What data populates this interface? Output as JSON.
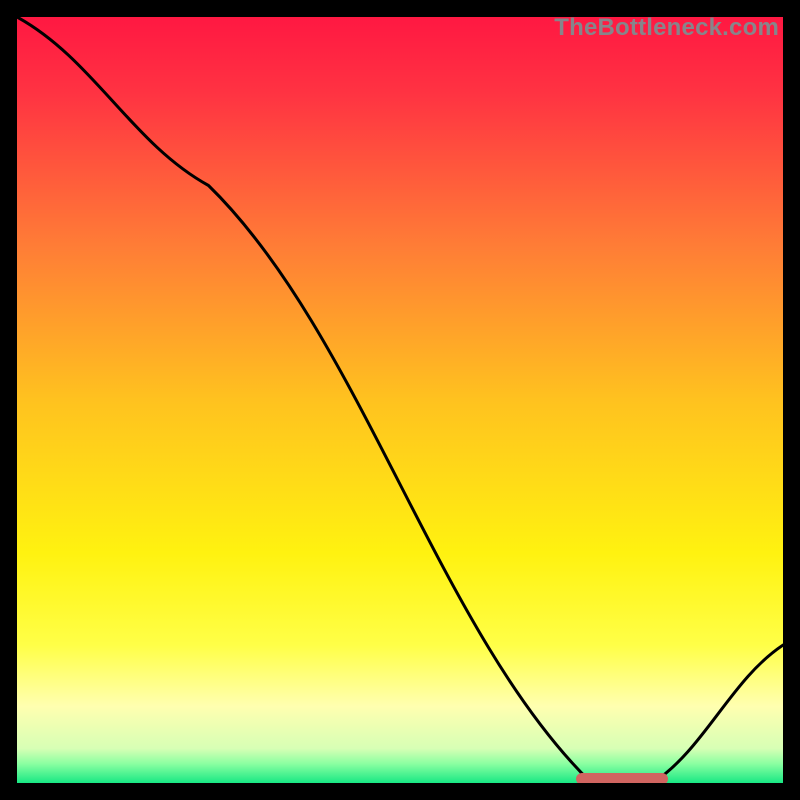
{
  "watermark": "TheBottleneck.com",
  "colors": {
    "frame": "#000000",
    "page": "#ffffff",
    "bar_mark": "#d16560",
    "line": "#000000",
    "gradient_stops": [
      {
        "offset": 0.0,
        "color": "#ff1842"
      },
      {
        "offset": 0.1,
        "color": "#ff3342"
      },
      {
        "offset": 0.3,
        "color": "#ff7d36"
      },
      {
        "offset": 0.5,
        "color": "#ffc21f"
      },
      {
        "offset": 0.7,
        "color": "#fff210"
      },
      {
        "offset": 0.82,
        "color": "#ffff47"
      },
      {
        "offset": 0.9,
        "color": "#ffffb0"
      },
      {
        "offset": 0.955,
        "color": "#d7ffb5"
      },
      {
        "offset": 0.975,
        "color": "#8affa1"
      },
      {
        "offset": 1.0,
        "color": "#18e884"
      }
    ]
  },
  "chart_data": {
    "type": "line",
    "title": "",
    "xlabel": "",
    "ylabel": "",
    "xlim": [
      0,
      100
    ],
    "ylim": [
      0,
      100
    ],
    "x": [
      0,
      25,
      75,
      83,
      100
    ],
    "values": [
      100,
      78,
      0,
      0,
      18
    ],
    "annotations": [
      {
        "kind": "bar_marker",
        "x_start": 73,
        "x_end": 85,
        "y": 0.5
      }
    ]
  }
}
